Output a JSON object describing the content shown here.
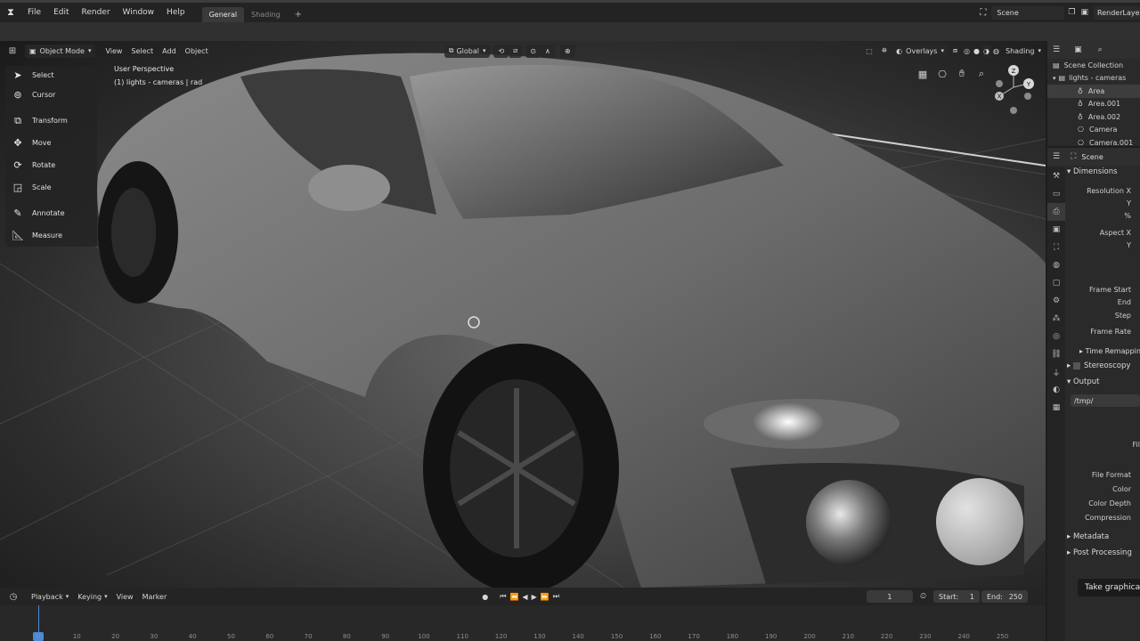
{
  "app": {
    "logo_glyph": "⧗"
  },
  "menu": [
    "File",
    "Edit",
    "Render",
    "Window",
    "Help"
  ],
  "workspaces": [
    {
      "label": "General",
      "active": true
    },
    {
      "label": "Shading",
      "active": false
    }
  ],
  "add_workspace": "+",
  "scene": {
    "name": "Scene",
    "layer": "RenderLayer"
  },
  "viewport_header": {
    "mode": "Object Mode",
    "menus": [
      "View",
      "Select",
      "Add",
      "Object"
    ],
    "transform_orientation": "Global",
    "overlays": "Overlays",
    "shading": "Shading"
  },
  "hud": {
    "view_name": "User Perspective",
    "collection": "(1) lights - cameras | rad"
  },
  "tools": [
    {
      "label": "Select",
      "icon": "select-arrow-icon"
    },
    {
      "label": "Cursor",
      "icon": "cursor-icon"
    },
    {
      "label": "Transform",
      "icon": "transform-icon"
    },
    {
      "label": "Move",
      "icon": "move-icon"
    },
    {
      "label": "Rotate",
      "icon": "rotate-icon"
    },
    {
      "label": "Scale",
      "icon": "scale-icon"
    },
    {
      "label": "Annotate",
      "icon": "annotate-icon"
    },
    {
      "label": "Measure",
      "icon": "measure-icon"
    }
  ],
  "navigation_gizmo": {
    "z": "Z",
    "y": "Y",
    "x": "X"
  },
  "outliner": {
    "root": "Scene Collection",
    "collection": "lights - cameras",
    "items": [
      "Area",
      "Area.001",
      "Area.002",
      "Camera",
      "Camera.001"
    ]
  },
  "properties": {
    "context": "Scene",
    "panels": {
      "dimensions": "Dimensions",
      "resolution_x": "Resolution X",
      "y": "Y",
      "percent": "%",
      "aspect_x": "Aspect X",
      "aspect_y": "Y",
      "frame_start": "Frame Start",
      "end": "End",
      "step": "Step",
      "frame_rate": "Frame Rate",
      "time_remapping": "Time Remapping",
      "stereoscopy": "Stereoscopy",
      "output": "Output",
      "output_path": "/tmp/",
      "file_label": "Fil",
      "file_format": "File Format",
      "color": "Color",
      "color_depth": "Color Depth",
      "compression": "Compression",
      "metadata": "Metadata",
      "post_processing": "Post Processing"
    }
  },
  "timeline": {
    "menus": [
      "Playback",
      "Keying",
      "View",
      "Marker"
    ],
    "current_frame": "1",
    "start_label": "Start:",
    "start": "1",
    "end_label": "End:",
    "end": "250",
    "ticks": [
      "0",
      "10",
      "20",
      "30",
      "40",
      "50",
      "60",
      "70",
      "80",
      "90",
      "100",
      "110",
      "120",
      "130",
      "140",
      "150",
      "160",
      "170",
      "180",
      "190",
      "200",
      "210",
      "220",
      "230",
      "240",
      "250"
    ]
  },
  "tooltip": "Take graphica"
}
